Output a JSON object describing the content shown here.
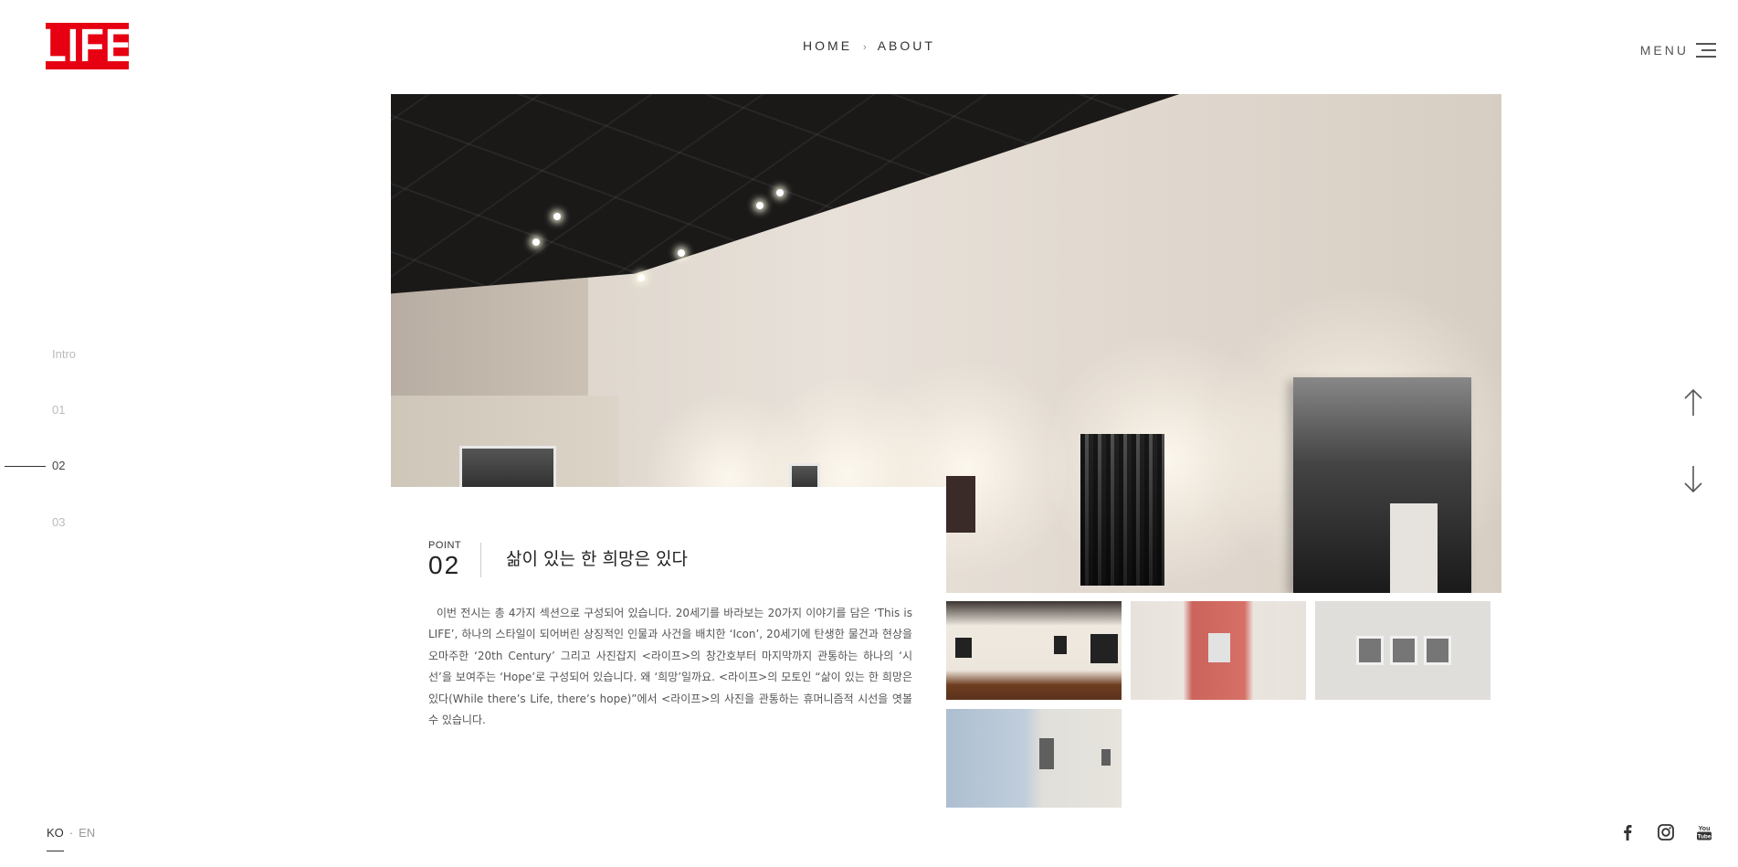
{
  "brand": {
    "logo_text": "LIFE",
    "accent": "#e60012"
  },
  "breadcrumb": {
    "home": "HOME",
    "separator": "›",
    "current": "ABOUT"
  },
  "menu": {
    "label": "MENU"
  },
  "side_nav": {
    "items": [
      "Intro",
      "01",
      "02",
      "03"
    ],
    "active": "02"
  },
  "point": {
    "label": "POINT",
    "number": "02",
    "title": "삶이 있는 한 희망은 있다",
    "body": "이번 전시는 총 4가지 섹션으로 구성되어 있습니다. 20세기를 바라보는 20가지 이야기를 담은 ‘This is LIFE’, 하나의 스타일이 되어버린 상징적인 인물과 사건을 배치한 ‘Icon’, 20세기에 탄생한 물건과 현상을 오마주한 ‘20th Century’ 그리고 사진잡지 <라이프>의 창간호부터 마지막까지 관통하는 하나의 ‘시선’을 보여주는 ‘Hope’로 구성되어 있습니다. 왜 ‘희망’일까요. <라이프>의 모토인 “삶이 있는 한 희망은 있다(While there’s Life, there’s hope)”에서 <라이프>의 사진을 관통하는 휴머니즘적 시선을 엿볼 수 있습니다."
  },
  "language": {
    "ko": "KO",
    "separator": "·",
    "en": "EN"
  },
  "icons": {
    "scroll_up": "arrow-up-icon",
    "scroll_down": "arrow-down-icon",
    "facebook": "facebook-icon",
    "instagram": "instagram-icon",
    "youtube": "youtube-icon",
    "menu": "hamburger-icon"
  }
}
